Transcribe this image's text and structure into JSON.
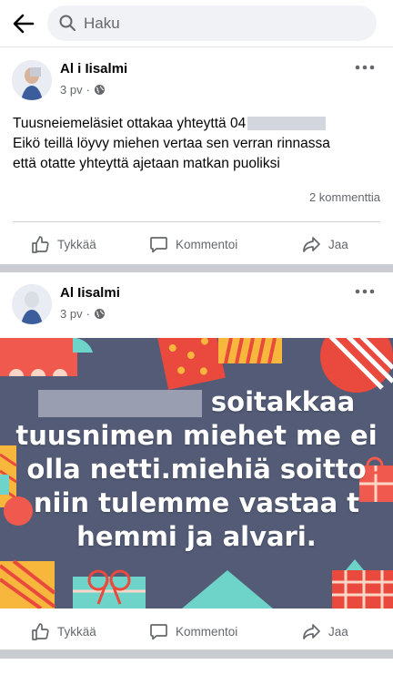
{
  "search": {
    "placeholder": "Haku"
  },
  "posts": [
    {
      "author": "Al i Iisalmi",
      "time": "3 pv",
      "text_line1": "Tuusneiemeläsiet ottakaa yhteyttä 04",
      "text_line2": "Eikö teillä löyvy miehen vertaa sen verran rinnassa",
      "text_line3": "että otatte yhteyttä ajetaan matkan puoliksi",
      "comments": "2 kommenttia"
    },
    {
      "author": "Al Iisalmi",
      "time": "3 pv",
      "image_lines": [
        "soitakkaa",
        "tuusnimen miehet me ei",
        "olla netti.miehiä soitto",
        "niin tulemme vastaa t",
        "hemmi ja alvari."
      ]
    }
  ],
  "actions": {
    "like": "Tykkää",
    "comment": "Kommentoi",
    "share": "Jaa"
  },
  "colors": {
    "icon_gray": "#65676b",
    "separator": "#c9ccd1",
    "image_bg": "#535b76"
  },
  "icons": [
    "back-arrow-icon",
    "search-icon",
    "more-icon",
    "globe-icon",
    "like-icon",
    "comment-icon",
    "share-icon"
  ]
}
